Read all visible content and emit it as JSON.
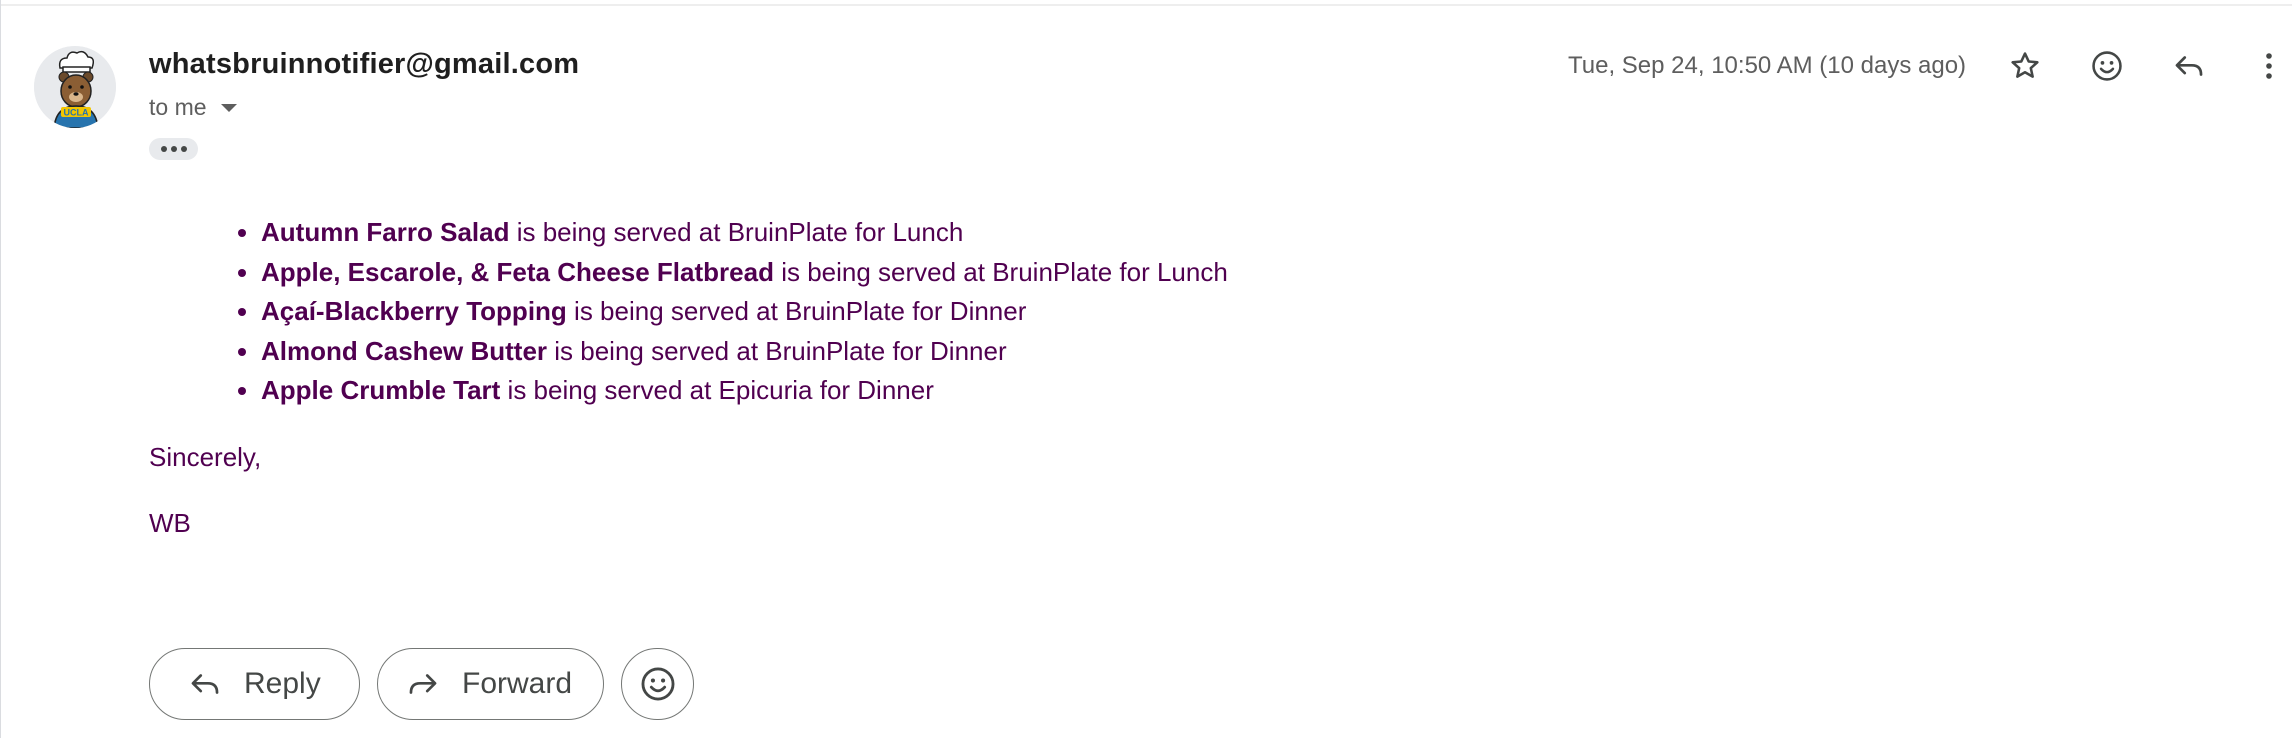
{
  "email": {
    "sender": "whatsbruinnotifier@gmail.com",
    "recipient_label": "to me",
    "date": "Tue, Sep 24, 10:50 AM (10 days ago)",
    "avatar_icon": "bear-chef-avatar"
  },
  "header_icons": [
    "star-icon",
    "emoji-icon",
    "reply-icon",
    "more-vert-icon"
  ],
  "items": [
    {
      "dish": "Autumn Farro Salad",
      "text": " is being served at BruinPlate for Lunch"
    },
    {
      "dish": "Apple, Escarole, & Feta Cheese Flatbread",
      "text": " is being served at BruinPlate for Lunch"
    },
    {
      "dish": "Açaí-Blackberry Topping",
      "text": " is being served at BruinPlate for Dinner"
    },
    {
      "dish": "Almond Cashew Butter",
      "text": " is being served at BruinPlate for Dinner"
    },
    {
      "dish": "Apple Crumble Tart",
      "text": " is being served at Epicuria for Dinner"
    }
  ],
  "closing": "Sincerely,",
  "signature": "WB",
  "actions": {
    "reply_label": "Reply",
    "forward_label": "Forward"
  },
  "colors": {
    "body_text": "#500050",
    "sender_text": "#1f1f1f",
    "muted_text": "#5e5e5e"
  }
}
